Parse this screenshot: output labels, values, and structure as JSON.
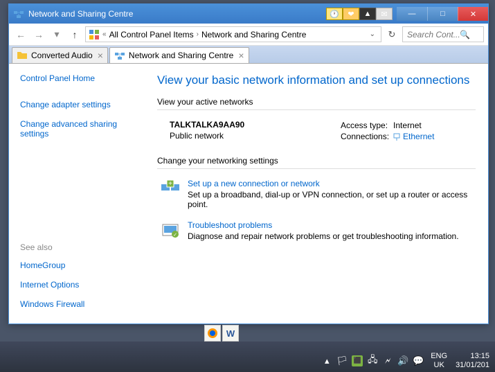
{
  "window": {
    "title": "Network and Sharing Centre",
    "buttons": {
      "min": "—",
      "max": "□",
      "close": "✕"
    }
  },
  "nav": {
    "back": "←",
    "forward": "→",
    "dropdown": "▾",
    "up": "↑",
    "breadcrumb_sep1": "«",
    "breadcrumb_item1": "All Control Panel Items",
    "breadcrumb_sep2": "›",
    "breadcrumb_item2": "Network and Sharing Centre",
    "refresh": "↻",
    "search_placeholder": "Search Cont..."
  },
  "tabs": {
    "tab1": {
      "label": "Converted Audio",
      "close": "×"
    },
    "tab2": {
      "label": "Network and Sharing Centre",
      "close": "×"
    }
  },
  "sidebar": {
    "home": "Control Panel Home",
    "link1": "Change adapter settings",
    "link2": "Change advanced sharing settings",
    "seealso_title": "See also",
    "seealso1": "HomeGroup",
    "seealso2": "Internet Options",
    "seealso3": "Windows Firewall"
  },
  "main": {
    "heading": "View your basic network information and set up connections",
    "active_label": "View your active networks",
    "network": {
      "name": "TALKTALKA9AA90",
      "type": "Public network",
      "access_label": "Access type:",
      "access_value": "Internet",
      "conn_label": "Connections:",
      "conn_value": "Ethernet"
    },
    "change_label": "Change your networking settings",
    "setup": {
      "title": "Set up a new connection or network",
      "desc": "Set up a broadband, dial-up or VPN connection, or set up a router or access point."
    },
    "troubleshoot": {
      "title": "Troubleshoot problems",
      "desc": "Diagnose and repair network problems or get troubleshooting information."
    }
  },
  "systray": {
    "lang1": "ENG",
    "lang2": "UK",
    "time": "13:15",
    "date": "31/01/201"
  }
}
